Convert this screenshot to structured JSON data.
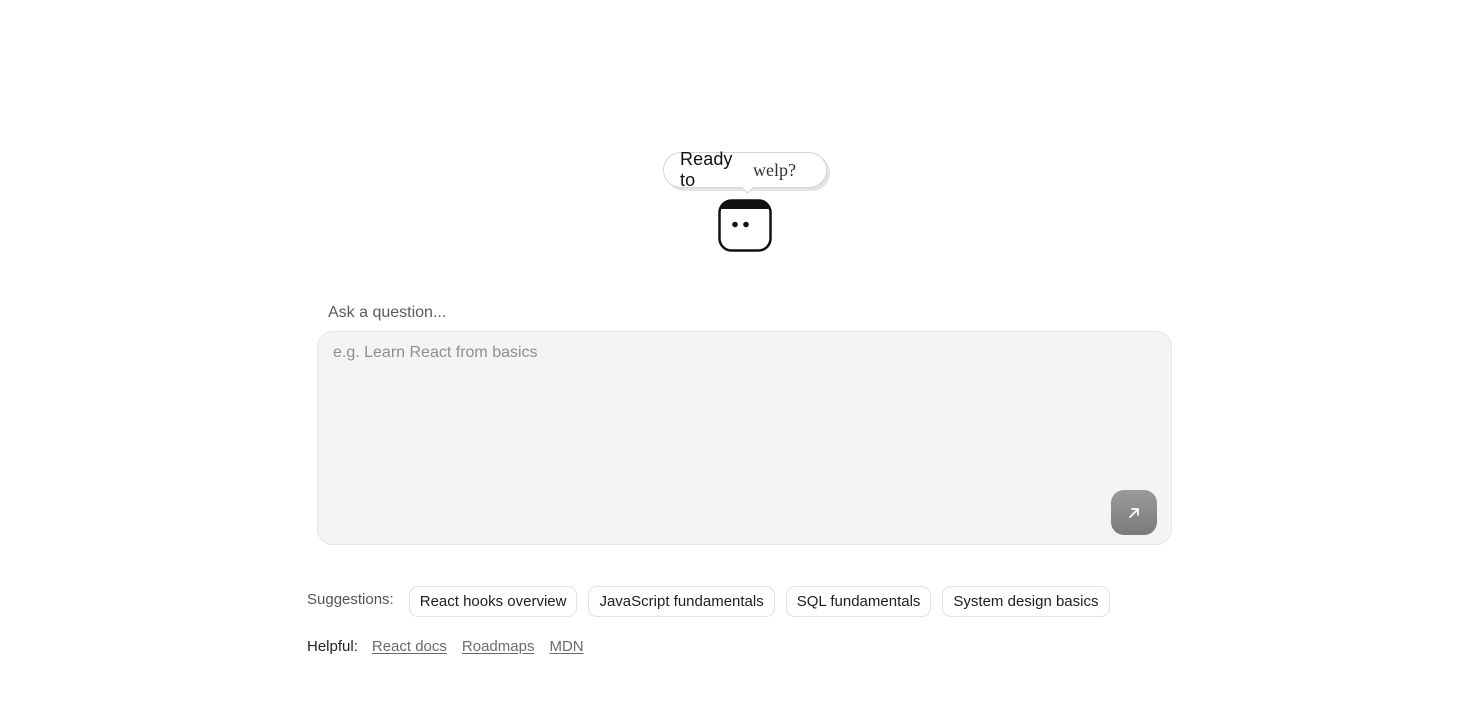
{
  "bubble": {
    "prefix": "Ready to",
    "word": "welp?"
  },
  "mascot": {
    "icon": "robot-face-icon"
  },
  "question": {
    "label": "Ask a question...",
    "placeholder": "e.g. Learn React from basics",
    "value": "",
    "send_icon": "arrow-up-right-icon"
  },
  "suggestions": {
    "label": "Suggestions:",
    "items": [
      {
        "label": "React hooks overview"
      },
      {
        "label": "JavaScript fundamentals"
      },
      {
        "label": "SQL fundamentals"
      },
      {
        "label": "System design basics"
      }
    ]
  },
  "helpful": {
    "label": "Helpful:",
    "links": [
      {
        "label": "React docs"
      },
      {
        "label": "Roadmaps"
      },
      {
        "label": "MDN"
      }
    ]
  }
}
